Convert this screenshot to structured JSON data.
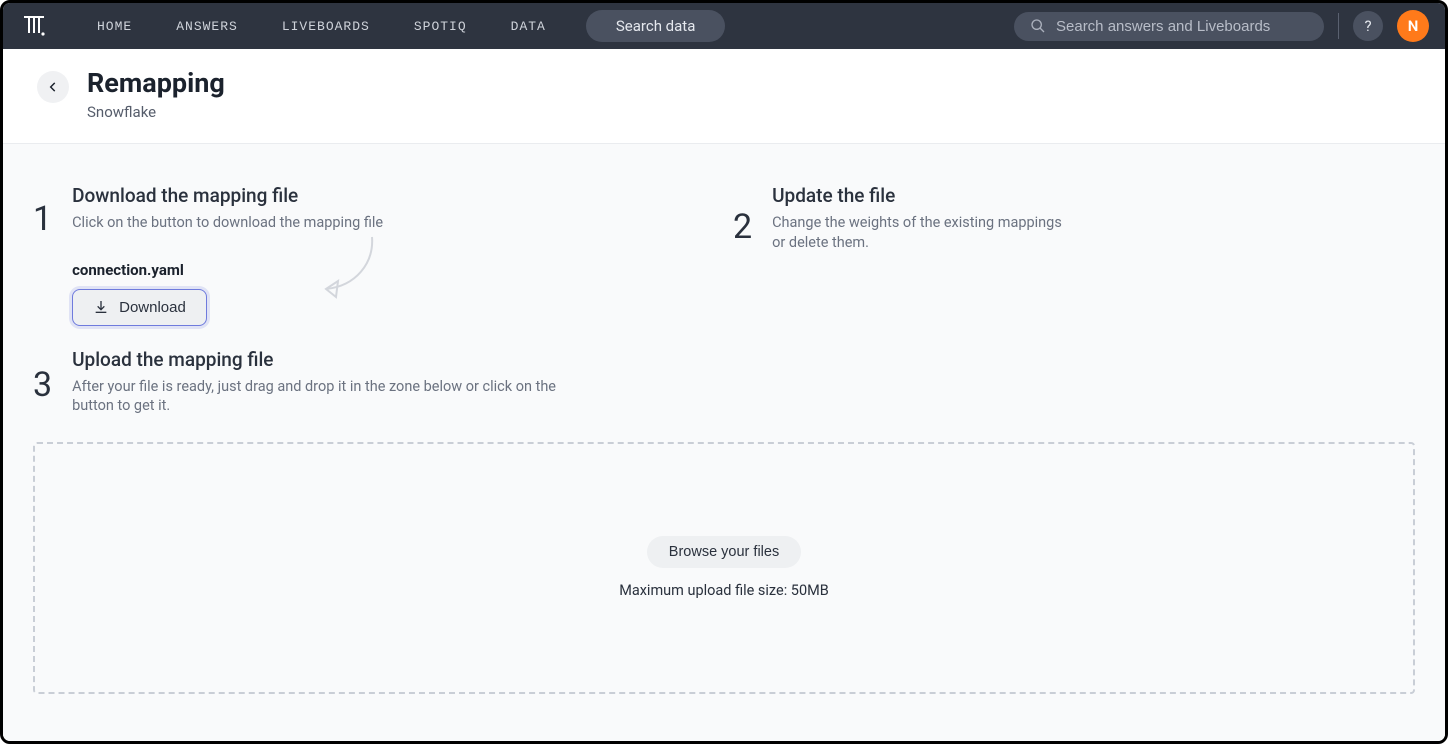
{
  "nav": {
    "items": [
      "HOME",
      "ANSWERS",
      "LIVEBOARDS",
      "SPOTIQ",
      "DATA"
    ],
    "search_pill": "Search data",
    "search_placeholder": "Search answers and Liveboards",
    "help": "?",
    "avatar_initial": "N"
  },
  "header": {
    "title": "Remapping",
    "subtitle": "Snowflake"
  },
  "steps": {
    "s1": {
      "num": "1",
      "title": "Download the mapping file",
      "desc": "Click on the button to download the mapping file",
      "file_name": "connection.yaml",
      "download_label": "Download"
    },
    "s2": {
      "num": "2",
      "title": "Update the file",
      "desc": "Change the weights of the existing mappings or delete them."
    },
    "s3": {
      "num": "3",
      "title": "Upload the mapping file",
      "desc": "After your file is ready, just drag and drop it in the zone below or click on the button to get it."
    }
  },
  "dropzone": {
    "browse": "Browse your files",
    "max": "Maximum upload file size: 50MB"
  }
}
